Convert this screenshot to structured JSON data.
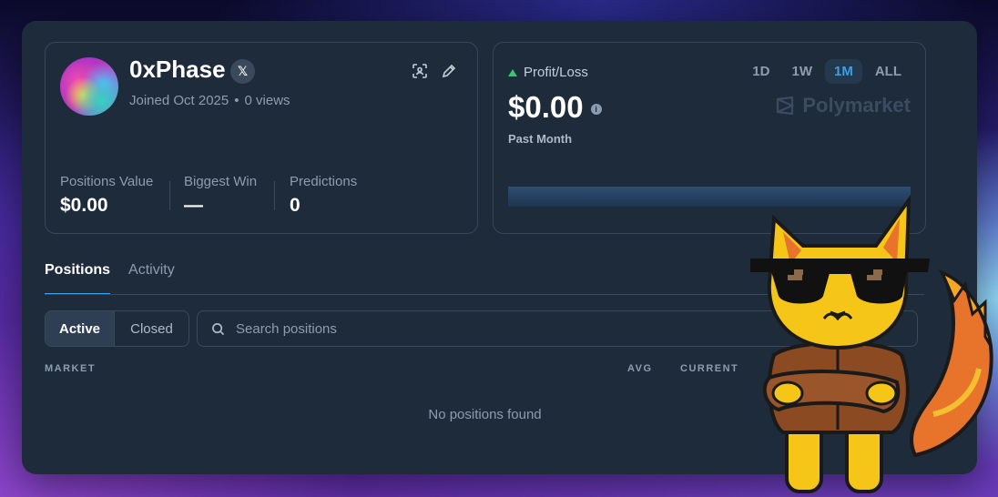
{
  "profile": {
    "name": "0xPhase",
    "social_icon": "x-logo-icon",
    "joined": "Joined Oct 2025",
    "separator": "•",
    "views": "0 views",
    "stats": [
      {
        "label": "Positions Value",
        "value": "$0.00"
      },
      {
        "label": "Biggest Win",
        "value": "—"
      },
      {
        "label": "Predictions",
        "value": "0"
      }
    ]
  },
  "pnl": {
    "label": "Profit/Loss",
    "value": "$0.00",
    "period_caption": "Past Month",
    "periods": [
      "1D",
      "1W",
      "1M",
      "ALL"
    ],
    "active_period": "1M",
    "brand": "Polymarket",
    "info_glyph": "i"
  },
  "tabs": [
    "Positions",
    "Activity"
  ],
  "active_tab": "Positions",
  "filter": {
    "active": "Active",
    "closed": "Closed"
  },
  "search": {
    "placeholder": "Search positions",
    "value": ""
  },
  "table": {
    "columns": [
      "MARKET",
      "AVG",
      "CURRENT"
    ],
    "empty": "No positions found"
  },
  "colors": {
    "accent": "#3aa0e8",
    "up": "#3cc56e",
    "panel": "#1e2b3a"
  }
}
